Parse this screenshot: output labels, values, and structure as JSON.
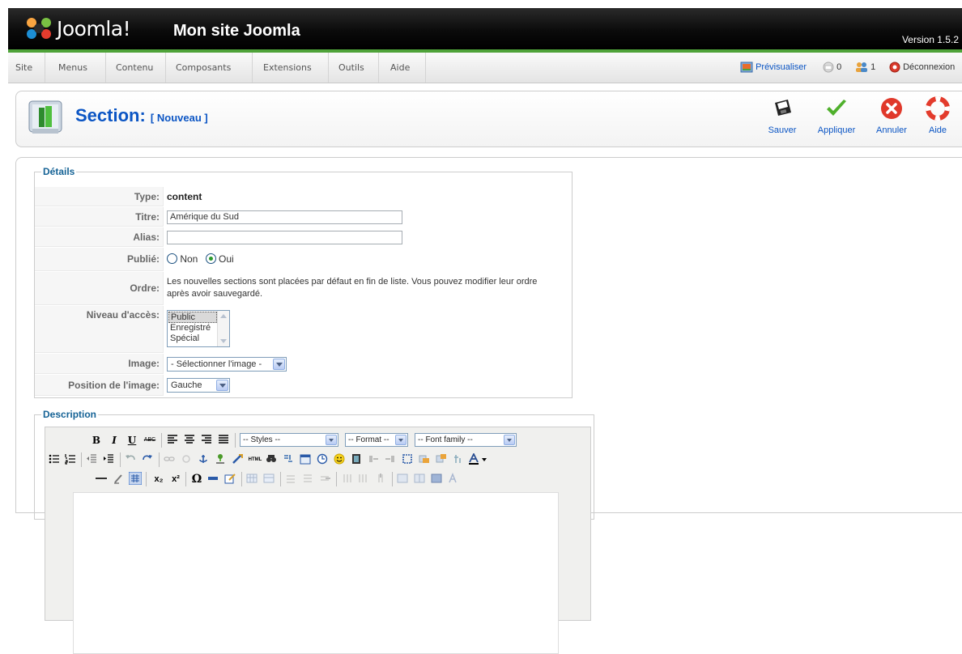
{
  "header": {
    "brand": "Joomla!",
    "site_name": "Mon site Joomla",
    "version": "Version 1.5.2"
  },
  "menu": {
    "items": [
      "Site",
      "Menus",
      "Contenu",
      "Composants",
      "Extensions",
      "Outils",
      "Aide"
    ],
    "preview_label": "Prévisualiser",
    "messages_count": "0",
    "users_count": "1",
    "logout_label": "Déconnexion"
  },
  "toolbar": {
    "title": "Section:",
    "subtitle": "[ Nouveau ]",
    "buttons": [
      "Sauver",
      "Appliquer",
      "Annuler",
      "Aide"
    ]
  },
  "details": {
    "legend": "Détails",
    "type_label": "Type:",
    "type_value": "content",
    "title_label": "Titre:",
    "title_value": "Amérique du Sud",
    "alias_label": "Alias:",
    "alias_value": "",
    "published_label": "Publié:",
    "published_no": "Non",
    "published_yes": "Oui",
    "published_selected": "Oui",
    "order_label": "Ordre:",
    "order_text": "Les nouvelles sections sont placées par défaut en fin de liste. Vous pouvez modifier leur ordre après avoir sauvegardé.",
    "access_label": "Niveau d'accès:",
    "access_options": [
      "Public",
      "Enregistré",
      "Spécial"
    ],
    "access_selected": "Public",
    "image_label": "Image:",
    "image_value": "- Sélectionner l'image -",
    "image_position_label": "Position de l'image:",
    "image_position_value": "Gauche"
  },
  "description": {
    "legend": "Description",
    "styles_select": "-- Styles --",
    "format_select": "-- Format --",
    "font_select": "-- Font family --",
    "bold": "B",
    "italic": "I",
    "underline": "U",
    "strike": "ABC",
    "subscript": "x₂",
    "superscript": "x²",
    "omega": "Ω",
    "html": "HTML"
  },
  "colors": {
    "accent": "#0b55c4",
    "legend": "#146295",
    "green_bar": "#4fa33a"
  }
}
